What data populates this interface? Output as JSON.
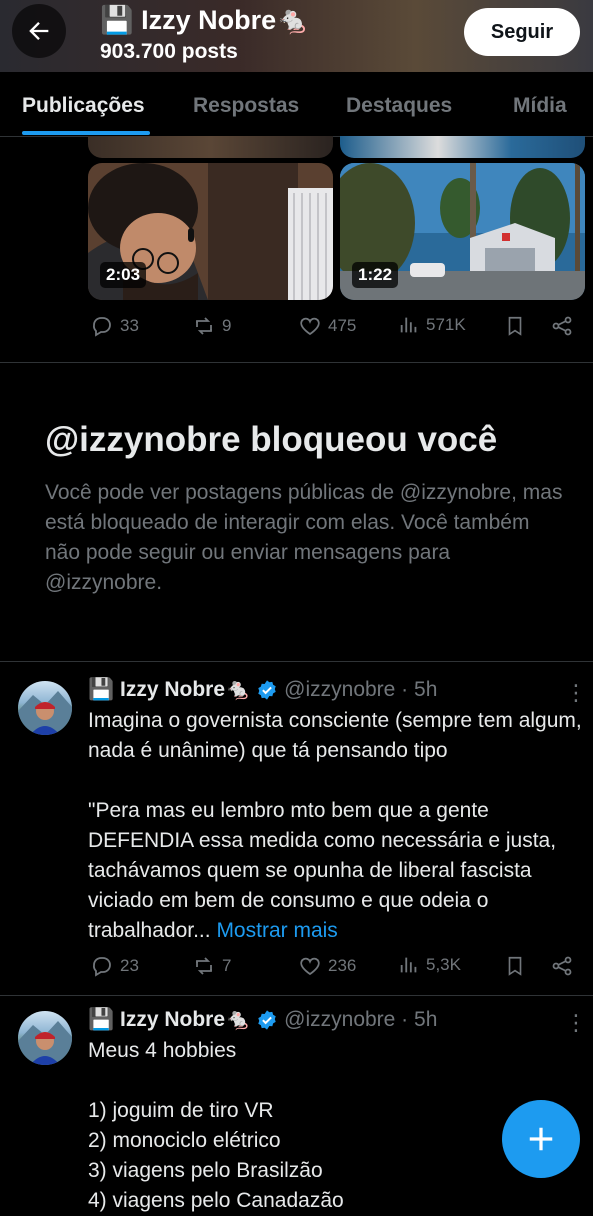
{
  "header": {
    "name": "💾 Izzy Nobre🐁",
    "posts_count": "903.700 posts",
    "follow_label": "Seguir"
  },
  "tabs": [
    {
      "label": "Publicações",
      "active": true
    },
    {
      "label": "Respostas",
      "active": false
    },
    {
      "label": "Destaques",
      "active": false
    },
    {
      "label": "Mídia",
      "active": false
    }
  ],
  "post1": {
    "video1_duration": "2:03",
    "video2_duration": "1:22",
    "replies": "33",
    "reposts": "9",
    "likes": "475",
    "views": "571K"
  },
  "blocked": {
    "title": "@izzynobre bloqueou você",
    "text": "Você pode ver postagens públicas de @izzynobre, mas está bloqueado de interagir com elas. Você também não pode seguir ou enviar mensagens para @izzynobre."
  },
  "tweets": [
    {
      "name": "💾 Izzy Nobre🐁",
      "handle": "@izzynobre · 5h",
      "text": "Imagina o governista consciente (sempre tem algum, nada é unânime) que tá pensando tipo\n\n\"Pera mas eu lembro mto bem que a gente DEFENDIA essa medida como necessária e justa, tachávamos quem se opunha de liberal fascista viciado em bem de consumo e que odeia o trabalhador...",
      "show_more": "Mostrar mais",
      "replies": "23",
      "reposts": "7",
      "likes": "236",
      "views": "5,3K"
    },
    {
      "name": "💾 Izzy Nobre🐁",
      "handle": "@izzynobre · 5h",
      "text": "Meus 4 hobbies\n\n1) joguim de tiro VR\n2) monociclo elétrico\n3) viagens pelo Brasilzão\n4) viagens pelo Canadazão"
    }
  ],
  "colors": {
    "accent": "#1d9bf0",
    "muted": "#71767b",
    "text": "#e7e9ea",
    "background": "#000000"
  },
  "icons": [
    "back-arrow-icon",
    "reply-icon",
    "repost-icon",
    "like-icon",
    "views-icon",
    "bookmark-icon",
    "share-icon",
    "verified-icon",
    "more-icon",
    "compose-plus-icon"
  ]
}
